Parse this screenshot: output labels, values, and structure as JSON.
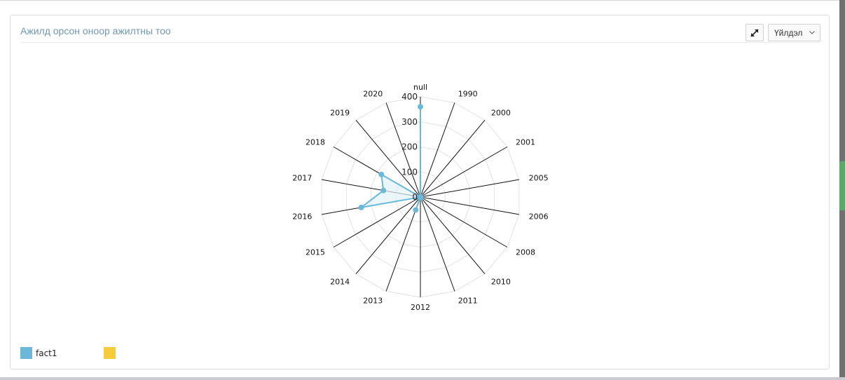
{
  "panel": {
    "title": "Ажилд орсон оноор ажилтны тоо",
    "dropdown_label": "Үйлдэл",
    "expand_icon": "expand-arrows-icon",
    "dropdown_icon": "chevron-down-icon"
  },
  "colors": {
    "series": "#6bb9d8",
    "series_fill": "#e2f2f9",
    "legend_second": "#f6cc3a"
  },
  "chart_data": {
    "type": "radar",
    "categories": [
      "null",
      "1990",
      "2000",
      "2001",
      "2005",
      "2006",
      "2008",
      "2010",
      "2011",
      "2012",
      "2013",
      "2014",
      "2015",
      "2016",
      "2017",
      "2018",
      "2019",
      "2020"
    ],
    "radial_ticks": [
      "0",
      "100",
      "200",
      "300",
      "400"
    ],
    "rmax": 400,
    "grid": true,
    "legend_position": "bottom-left",
    "series": [
      {
        "name": "fact1",
        "values": [
          360,
          1,
          1,
          1,
          1,
          1,
          1,
          1,
          4,
          3,
          55,
          1,
          1,
          240,
          150,
          180,
          1,
          1
        ]
      }
    ],
    "legend": [
      {
        "label": "fact1",
        "color": "#6bb9d8"
      },
      {
        "label": "",
        "color": "#f6cc3a"
      }
    ]
  }
}
